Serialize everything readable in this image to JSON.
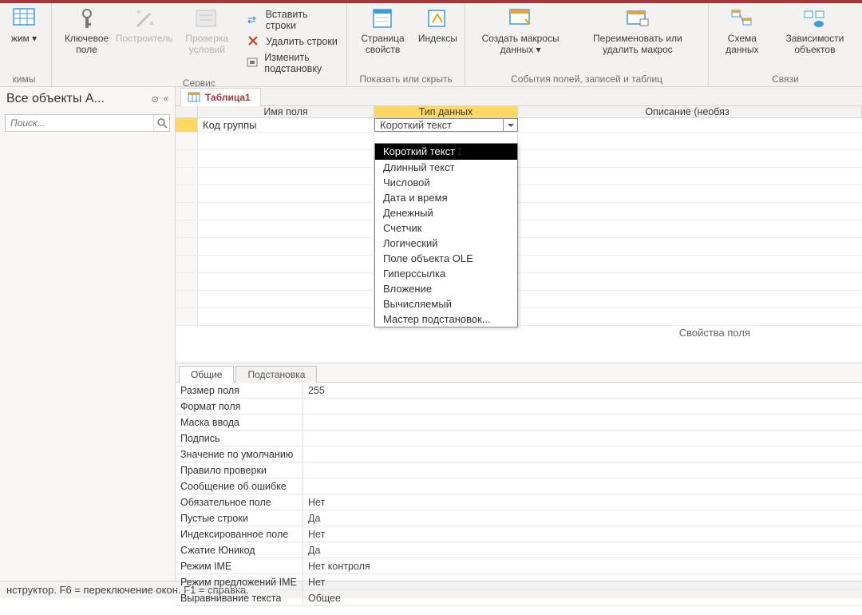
{
  "ribbon": {
    "groups": [
      {
        "caption": "кимы",
        "buttons": [
          {
            "label": "жим\n▾",
            "name": "view-mode-button"
          }
        ]
      },
      {
        "caption": "Сервис",
        "buttons": [
          {
            "label": "Ключевое\nполе",
            "name": "primary-key-button"
          },
          {
            "label": "Построитель",
            "name": "builder-button",
            "disabled": true
          },
          {
            "label": "Проверка\nусловий",
            "name": "validate-rules-button",
            "disabled": true
          }
        ],
        "small": [
          {
            "label": "Вставить строки",
            "name": "insert-rows-button"
          },
          {
            "label": "Удалить строки",
            "name": "delete-rows-button"
          },
          {
            "label": "Изменить подстановку",
            "name": "modify-lookup-button"
          }
        ]
      },
      {
        "caption": "Показать или скрыть",
        "buttons": [
          {
            "label": "Страница\nсвойств",
            "name": "property-sheet-button"
          },
          {
            "label": "Индексы",
            "name": "indexes-button"
          }
        ]
      },
      {
        "caption": "События полей, записей и таблиц",
        "buttons": [
          {
            "label": "Создать макросы\nданных ▾",
            "name": "create-data-macros-button"
          },
          {
            "label": "Переименовать\nили удалить макрос",
            "name": "rename-delete-macro-button"
          }
        ]
      },
      {
        "caption": "Связи",
        "buttons": [
          {
            "label": "Схема\nданных",
            "name": "relationships-button"
          },
          {
            "label": "Зависимости\nобъектов",
            "name": "object-dependencies-button"
          }
        ]
      }
    ]
  },
  "nav": {
    "title": "Все объекты A...",
    "search_placeholder": "Поиск..."
  },
  "tab": {
    "label": "Таблица1"
  },
  "grid": {
    "headers": {
      "name": "Имя поля",
      "type": "Тип данных",
      "desc": "Описание (необяз"
    },
    "row": {
      "name": "Код группы",
      "type": "Короткий текст"
    },
    "dropdown": [
      "Короткий текст",
      "Длинный текст",
      "Числовой",
      "Дата и время",
      "Денежный",
      "Счетчик",
      "Логический",
      "Поле объекта OLE",
      "Гиперссылка",
      "Вложение",
      "Вычисляемый",
      "Мастер подстановок..."
    ],
    "dropdown_selected_index": 0
  },
  "props": {
    "section_label": "Свойства поля",
    "tabs": {
      "general": "Общие",
      "lookup": "Подстановка"
    },
    "rows": [
      {
        "label": "Размер поля",
        "value": "255"
      },
      {
        "label": "Формат поля",
        "value": ""
      },
      {
        "label": "Маска ввода",
        "value": ""
      },
      {
        "label": "Подпись",
        "value": ""
      },
      {
        "label": "Значение по умолчанию",
        "value": ""
      },
      {
        "label": "Правило проверки",
        "value": ""
      },
      {
        "label": "Сообщение об ошибке",
        "value": ""
      },
      {
        "label": "Обязательное поле",
        "value": "Нет"
      },
      {
        "label": "Пустые строки",
        "value": "Да"
      },
      {
        "label": "Индексированное поле",
        "value": "Нет"
      },
      {
        "label": "Сжатие Юникод",
        "value": "Да"
      },
      {
        "label": "Режим IME",
        "value": "Нет контроля"
      },
      {
        "label": "Режим предложений IME",
        "value": "Нет"
      },
      {
        "label": "Выравнивание текста",
        "value": "Общее"
      }
    ]
  },
  "status": "нструктор.  F6 = переключение окон.  F1 = справка."
}
